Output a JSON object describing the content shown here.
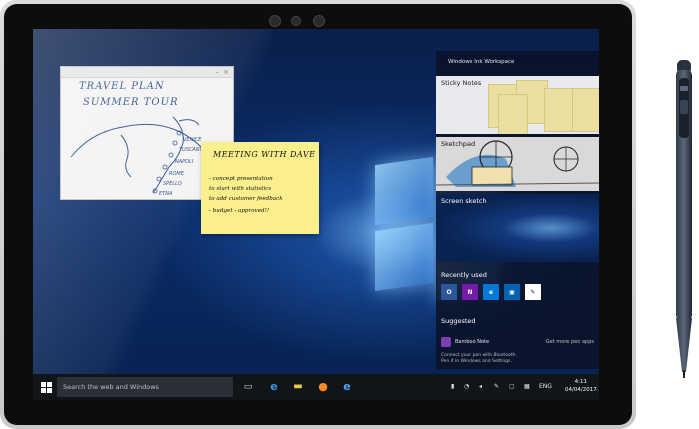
{
  "whiteboard": {
    "title_line1": "TRAVEL PLAN",
    "title_line2": "SUMMER TOUR",
    "places": [
      "VENICE",
      "TUSCANY",
      "NAPOLI",
      "ROME",
      "SPELLO",
      "ETNA"
    ],
    "close_glyph": "×",
    "minimize_glyph": "–"
  },
  "sticky": {
    "title": "MEETING WITH DAVE",
    "lines": [
      "- concept presentation",
      "   to start with statistics",
      "   to add customer feedback",
      "- budget - approved!!"
    ]
  },
  "ink_workspace": {
    "header": "Windows Ink Workspace",
    "sticky_notes_label": "Sticky Notes",
    "sketchpad_label": "Sketchpad",
    "screen_sketch_label": "Screen sketch",
    "recently_used_label": "Recently used",
    "recent_apps": [
      {
        "label": "O",
        "color": "#2b579a"
      },
      {
        "label": "N",
        "color": "#7719aa"
      },
      {
        "label": "e",
        "color": "#0078d7"
      },
      {
        "label": "▣",
        "color": "#0063b1"
      },
      {
        "label": "✎",
        "color": "#ffffff"
      }
    ],
    "suggested_label": "Suggested",
    "suggested_app": "Bamboo Note",
    "get_more": "Get more pen apps",
    "connect_line1": "Connect your pen with Bluetooth.",
    "connect_line2": "Pen it in Windows and Settings."
  },
  "taskbar": {
    "search_placeholder": "Search the web and Windows",
    "language": "ENG",
    "time": "4:11",
    "date": "04/04/2017"
  },
  "colors": {
    "accent": "#0078d7",
    "sticky": "#faef8c",
    "taskbar": "#111418"
  }
}
